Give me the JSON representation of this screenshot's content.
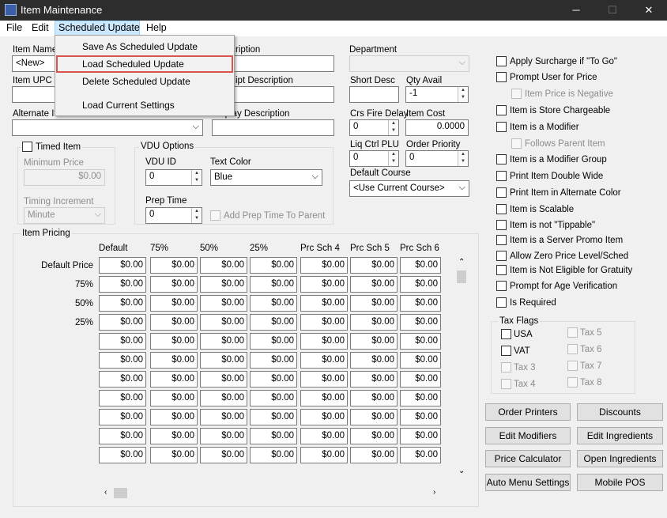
{
  "window": {
    "title": "Item Maintenance",
    "minimize": "─",
    "maximize": "☐",
    "close": "✕"
  },
  "menubar": [
    "File",
    "Edit",
    "Scheduled Update",
    "Help"
  ],
  "dropdown": [
    "Save As Scheduled Update",
    "Load Scheduled Update",
    "Delete Scheduled Update",
    "Load Current Settings"
  ],
  "fields": {
    "item_name_label": "Item Name",
    "item_name_value": "<New>",
    "item_upc_label": "Item UPC",
    "alt_item_label": "Alternate Item",
    "description_label": "ription",
    "receipt_desc_label": "ipt Description",
    "display_desc_label": "Display Description",
    "department_label": "Department",
    "short_desc_label": "Short Desc",
    "qty_avail_label": "Qty Avail",
    "qty_avail_value": "-1",
    "crs_fire_label": "Crs Fire Delay",
    "crs_fire_value": "0",
    "item_cost_label": "Item Cost",
    "item_cost_value": "0.0000",
    "liq_ctrl_label": "Liq Ctrl PLU",
    "liq_ctrl_value": "0",
    "order_priority_label": "Order Priority",
    "order_priority_value": "0",
    "default_course_label": "Default Course",
    "default_course_value": "<Use Current Course>"
  },
  "timed": {
    "label": "Timed Item",
    "min_price_label": "Minimum Price",
    "min_price_value": "$0.00",
    "timing_label": "Timing Increment",
    "timing_value": "Minute"
  },
  "vdu": {
    "title": "VDU Options",
    "vdu_id_label": "VDU ID",
    "vdu_id_value": "0",
    "text_color_label": "Text Color",
    "text_color_value": "Blue",
    "prep_time_label": "Prep Time",
    "prep_time_value": "0",
    "add_prep_label": "Add Prep Time To Parent"
  },
  "pricing": {
    "title": "Item Pricing",
    "columns": [
      "Default",
      "75%",
      "50%",
      "25%",
      "Prc Sch 4",
      "Prc Sch 5",
      "Prc Sch 6"
    ],
    "rows": [
      "Default Price",
      "75%",
      "50%",
      "25%",
      "",
      "",
      "",
      "",
      "",
      "",
      ""
    ],
    "cell_value": "$0.00"
  },
  "checkboxes": [
    "Apply Surcharge if \"To Go\"",
    "Prompt User for Price",
    "Item Price is Negative",
    "Item is Store Chargeable",
    "Item is a Modifier",
    "Follows Parent Item",
    "Item is a Modifier Group",
    "Print Item Double Wide",
    "Print Item in Alternate Color",
    "Item is Scalable",
    "Item is not \"Tippable\"",
    "Item is a Server Promo Item",
    "Allow Zero Price Level/Sched",
    "Item is Not Eligible for Gratuity",
    "Prompt for Age Verification",
    "Is Required"
  ],
  "tax": {
    "title": "Tax Flags",
    "items": [
      "USA",
      "VAT",
      "Tax 3",
      "Tax 4",
      "Tax 5",
      "Tax 6",
      "Tax 7",
      "Tax 8"
    ]
  },
  "buttons": [
    "Order Printers",
    "Discounts",
    "Edit Modifiers",
    "Edit Ingredients",
    "Price Calculator",
    "Open Ingredients",
    "Auto Menu Settings",
    "Mobile POS"
  ],
  "colors": {
    "highlight": "#d9534f",
    "titlebar": "#2d2d2d"
  }
}
